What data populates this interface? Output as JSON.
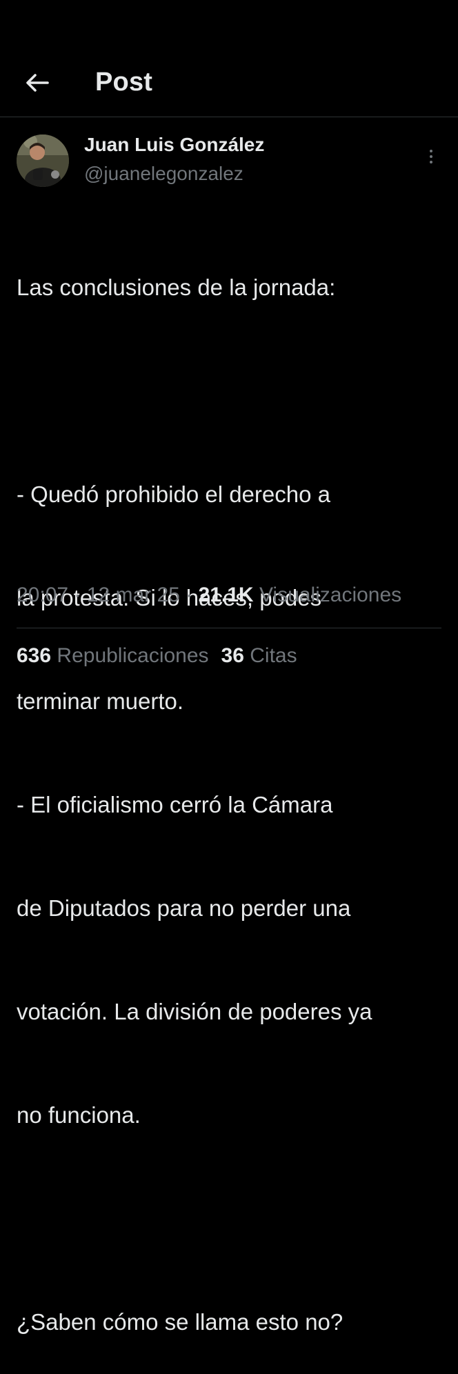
{
  "header": {
    "back_icon": "arrow-left-icon",
    "title": "Post"
  },
  "author": {
    "name": "Juan Luis González",
    "handle": "@juanelegonzalez",
    "more_icon": "vertical-ellipsis-icon"
  },
  "tweet": {
    "lines": [
      "Las conclusiones de la jornada:",
      "",
      "- Quedó prohibido el derecho a",
      "la protesta. Si lo haces, podes",
      "terminar muerto.",
      "- El oficialismo cerró la Cámara",
      "de Diputados para no perder una",
      "votación. La división de poderes ya",
      "no funciona.",
      "",
      "¿Saben cómo se llama esto no?"
    ]
  },
  "meta": {
    "time": "20:07",
    "date": "12 mar 25",
    "views_count": "21.1K",
    "views_label": "Visualizaciones",
    "separator": "·"
  },
  "stats": {
    "reposts_count": "636",
    "reposts_label": "Republicaciones",
    "quotes_count": "36",
    "quotes_label": "Citas"
  },
  "colors": {
    "background": "#000000",
    "text_primary": "#e7e9ea",
    "text_secondary": "#71767b",
    "divider": "#2f3336"
  }
}
